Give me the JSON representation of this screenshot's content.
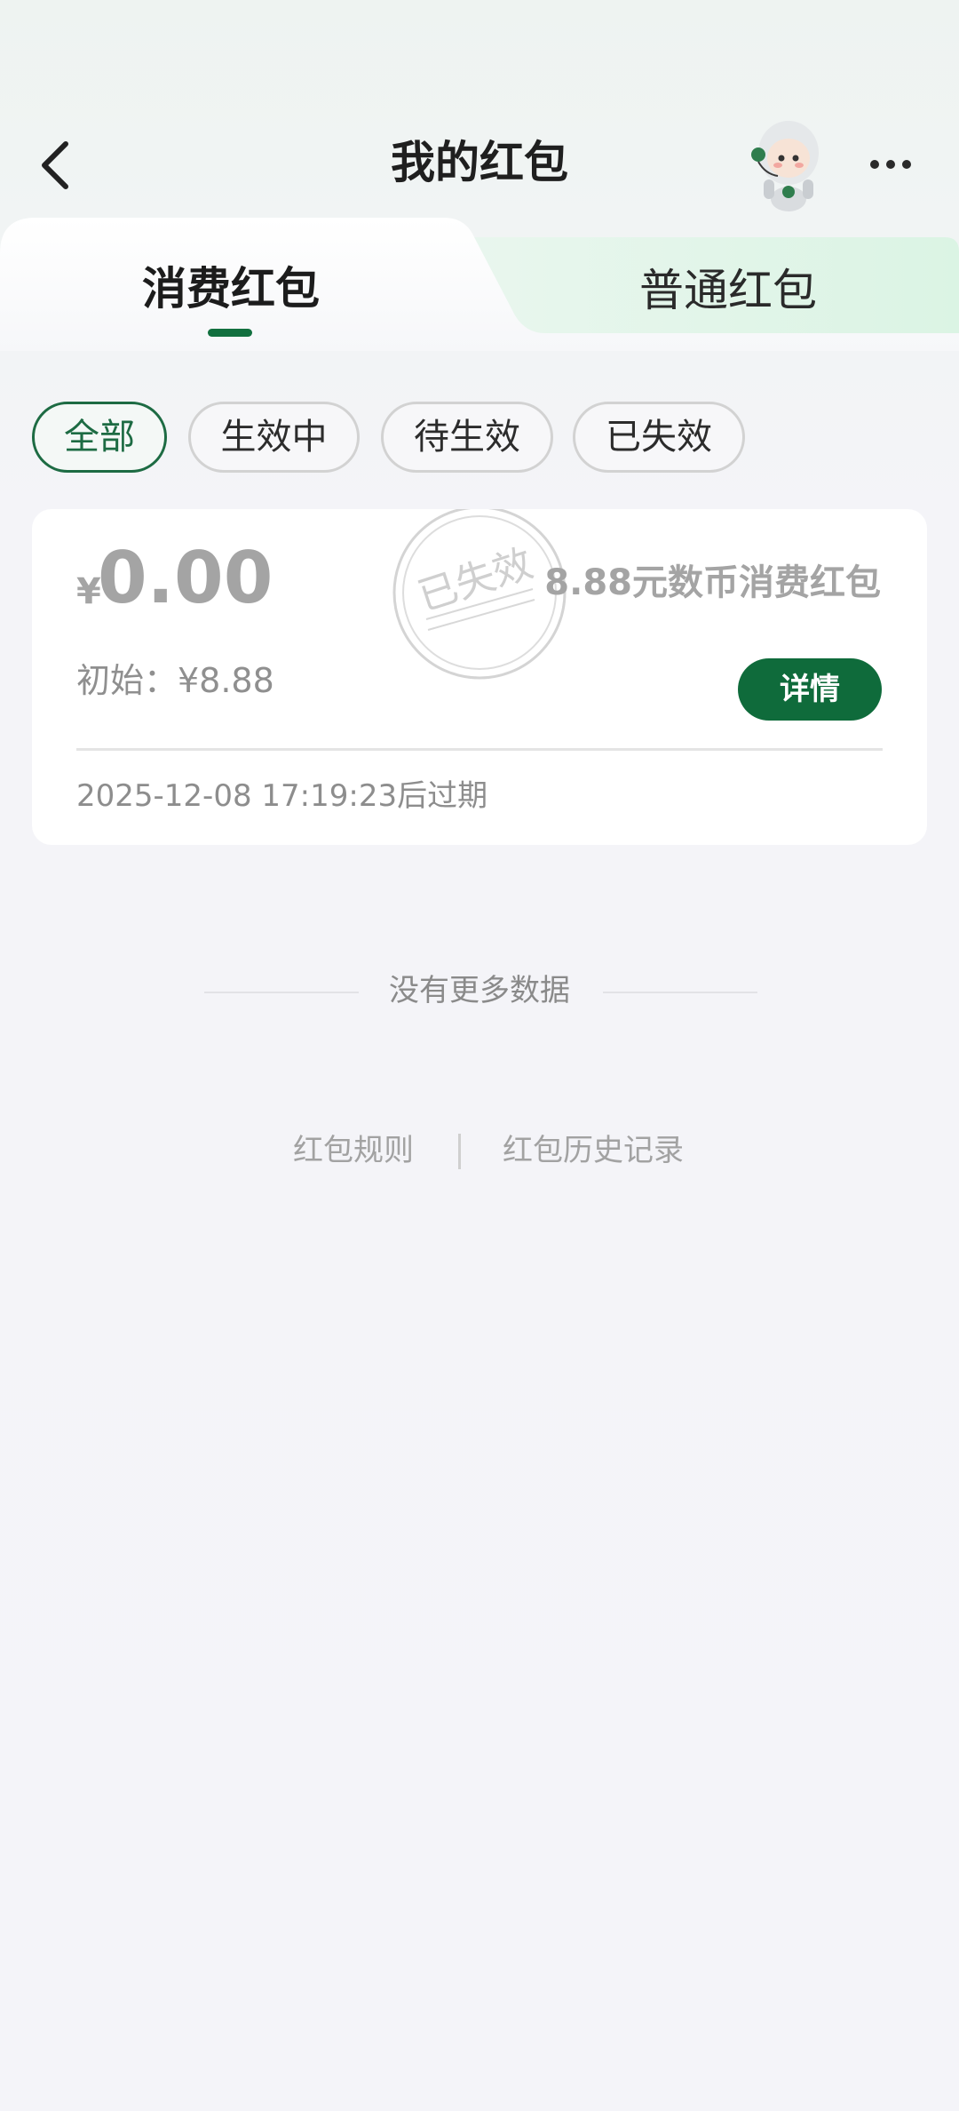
{
  "header": {
    "title": "我的红包",
    "back_icon": "chevron-left-icon",
    "more_icon": "more-dots-icon",
    "mascot": "robot-mascot"
  },
  "tabs": [
    {
      "label": "消费红包",
      "active": true
    },
    {
      "label": "普通红包",
      "active": false
    }
  ],
  "filters": [
    {
      "label": "全部",
      "active": true
    },
    {
      "label": "生效中",
      "active": false
    },
    {
      "label": "待生效",
      "active": false
    },
    {
      "label": "已失效",
      "active": false
    }
  ],
  "card": {
    "currency": "¥",
    "amount": "0.00",
    "name": "8.88元数币消费红包",
    "initial": "初始：¥8.88",
    "detail_label": "详情",
    "expiry": "2025-12-08 17:19:23后过期",
    "stamp_text": "已失效"
  },
  "list_end_text": "没有更多数据",
  "links": {
    "rules": "红包规则",
    "history": "红包历史记录"
  },
  "colors": {
    "accent": "#0f6b3b",
    "tab_inactive_bg": "#dff5e8"
  }
}
